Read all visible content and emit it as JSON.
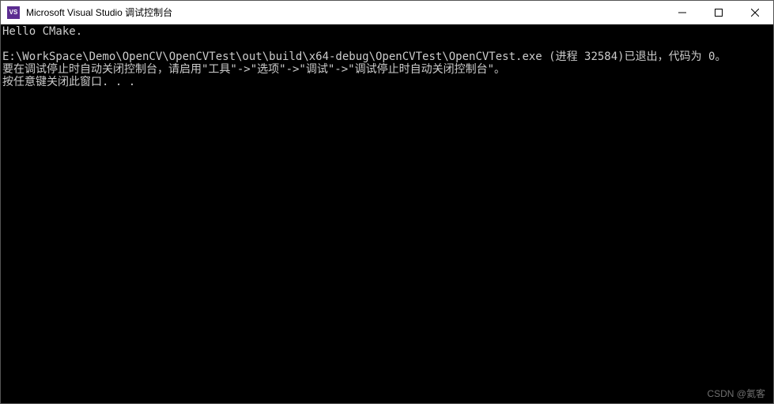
{
  "window": {
    "icon_label": "VS",
    "title": "Microsoft Visual Studio 调试控制台"
  },
  "console": {
    "lines": [
      "Hello CMake.",
      "",
      "E:\\WorkSpace\\Demo\\OpenCV\\OpenCVTest\\out\\build\\x64-debug\\OpenCVTest\\OpenCVTest.exe (进程 32584)已退出，代码为 0。",
      "要在调试停止时自动关闭控制台，请启用\"工具\"->\"选项\"->\"调试\"->\"调试停止时自动关闭控制台\"。",
      "按任意键关闭此窗口. . ."
    ]
  },
  "watermark": "CSDN @氦客"
}
